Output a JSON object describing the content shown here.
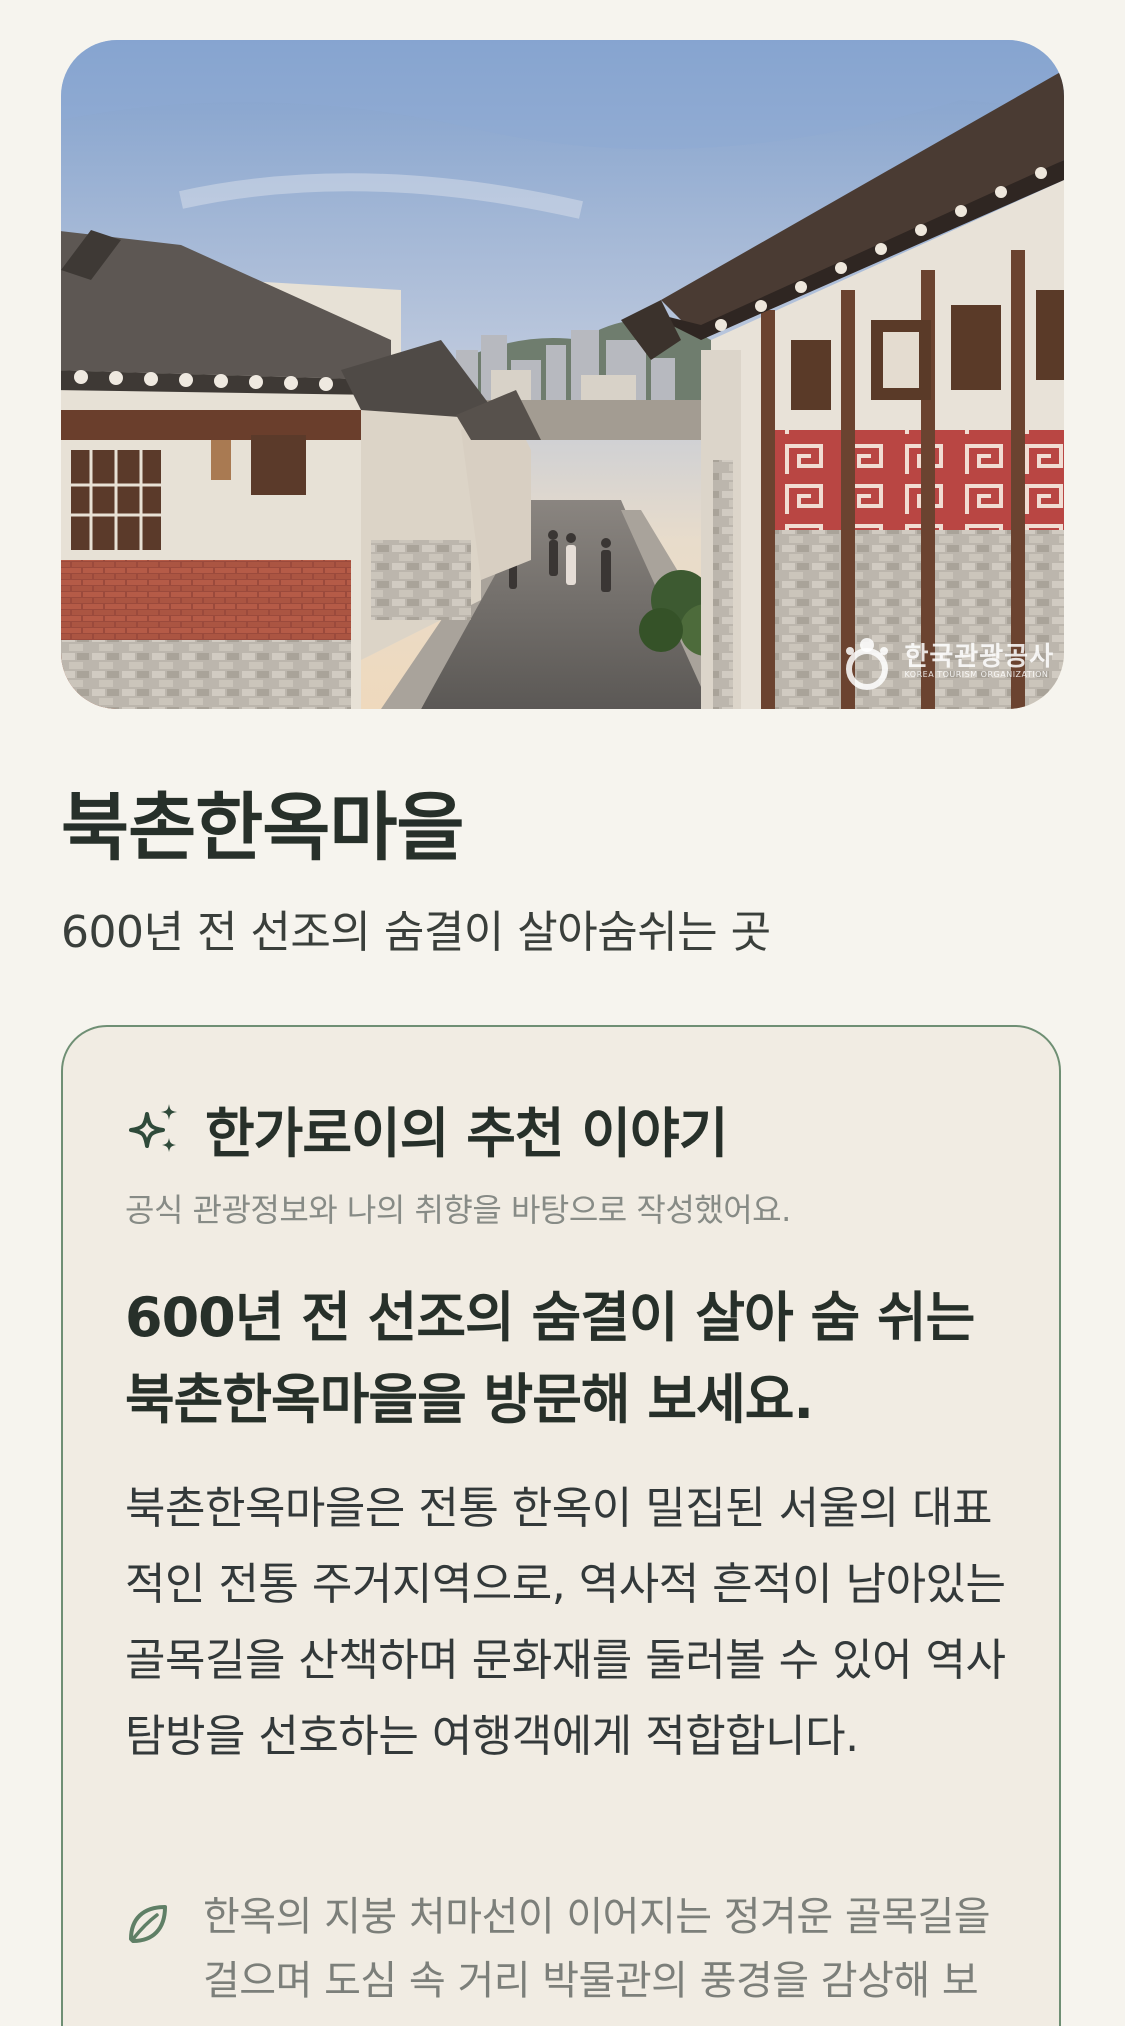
{
  "hero": {
    "image_alt": "북촌한옥마을 골목 풍경",
    "watermark_ko": "한국관광공사",
    "watermark_en": "KOREA TOURISM ORGANIZATION"
  },
  "place": {
    "title": "북촌한옥마을",
    "subtitle": "600년 전 선조의 숨결이 살아숨쉬는 곳"
  },
  "recommendation": {
    "icon": "sparkle-icon",
    "title": "한가로이의 추천 이야기",
    "caption": "공식 관광정보와 나의 취향을 바탕으로 작성했어요.",
    "headline": "600년 전 선조의 숨결이 살아 숨 쉬는 북촌한옥마을을 방문해 보세요.",
    "body": "북촌한옥마을은 전통 한옥이 밀집된 서울의 대표적인 전통 주거지역으로, 역사적 흔적이 남아있는 골목길을 산책하며 문화재를 둘러볼 수 있어 역사 탐방을 선호하는 여행객에게 적합합니다.",
    "point_icon": "leaf-icon",
    "point": "한옥의 지붕 처마선이 이어지는 정겨운 골목길을 걸으며 도심 속 거리 박물관의 풍경을 감상해 보"
  },
  "colors": {
    "background": "#f6f4ee",
    "card_background": "#f1ece3",
    "card_border": "#6f8f74",
    "text_primary": "#27302a",
    "text_muted": "#878b86"
  }
}
